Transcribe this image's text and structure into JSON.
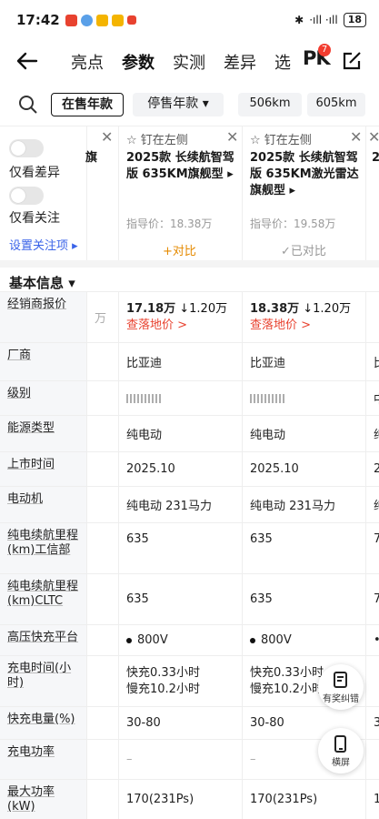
{
  "status": {
    "time": "17:42",
    "battery": "18",
    "signal": "·ıll ·ıll"
  },
  "nav": {
    "tabs": [
      "亮点",
      "参数",
      "实测",
      "差异",
      "选"
    ],
    "pk_label": "PK",
    "pk_count": "7"
  },
  "filter": {
    "on_sale": "在售年款",
    "off_sale": "停售年款 ▾",
    "range1": "506km",
    "range2": "605km"
  },
  "side": {
    "only_diff": "仅看差异",
    "only_follow": "仅看关注",
    "set_follow": "设置关注项 ▸"
  },
  "cars": [
    {
      "pin": "☆ 钉在左侧",
      "title": "2025款 长续航智驾版 635KM旗舰型 ▸",
      "price": "指导价：18.38万",
      "compare": "+对比",
      "compare_color": "#e58a00"
    },
    {
      "pin": "☆ 钉在左侧",
      "title": "2025款 长续航智驾版 635KM激光雷达旗舰型 ▸",
      "price": "指导价：19.58万",
      "compare": "✓已对比",
      "compare_color": "#999999"
    }
  ],
  "partial": {
    "left_title": "旗",
    "right_title": "2",
    "left_dealer": "万"
  },
  "section": {
    "title": "基本信息 ▾"
  },
  "rows": [
    {
      "label": "经销商报价",
      "c1a": "17.18万",
      "c1b": "↓1.20万",
      "c1c": "查落地价 >",
      "c2a": "18.38万",
      "c2b": "↓1.20万",
      "c2c": "查落地价 >"
    },
    {
      "label": "厂商",
      "c1": "比亚迪",
      "c2": "比亚迪",
      "c3": "比"
    },
    {
      "label": "级别",
      "c3": "中"
    },
    {
      "label": "能源类型",
      "c1": "纯电动",
      "c2": "纯电动",
      "c3": "纯"
    },
    {
      "label": "上市时间",
      "c1": "2025.10",
      "c2": "2025.10",
      "c3": "2"
    },
    {
      "label": "电动机",
      "c1": "纯电动 231马力",
      "c2": "纯电动 231马力",
      "c3": "纯"
    },
    {
      "label": "纯电续航里程(km)工信部",
      "c1": "635",
      "c2": "635",
      "c3": "7"
    },
    {
      "label": "纯电续航里程(km)CLTC",
      "c1": "635",
      "c2": "635",
      "c3": "7"
    },
    {
      "label": "高压快充平台",
      "c1": "800V",
      "c2": "800V",
      "c3": "•"
    },
    {
      "label": "充电时间(小时)",
      "c1a": "快充0.33小时",
      "c1b": "慢充10.2小时",
      "c2a": "快充0.33小时",
      "c2b": "慢充10.2小时"
    },
    {
      "label": "快充电量(%)",
      "c1": "30-80",
      "c2": "30-80",
      "c3": "3"
    },
    {
      "label": "充电功率",
      "c1": "–",
      "c2": "–"
    },
    {
      "label": "最大功率(kW)",
      "c1": "170(231Ps)",
      "c2": "170(231Ps)",
      "c3": "1"
    }
  ],
  "float": {
    "report": "有奖纠错",
    "landscape": "横屏"
  }
}
